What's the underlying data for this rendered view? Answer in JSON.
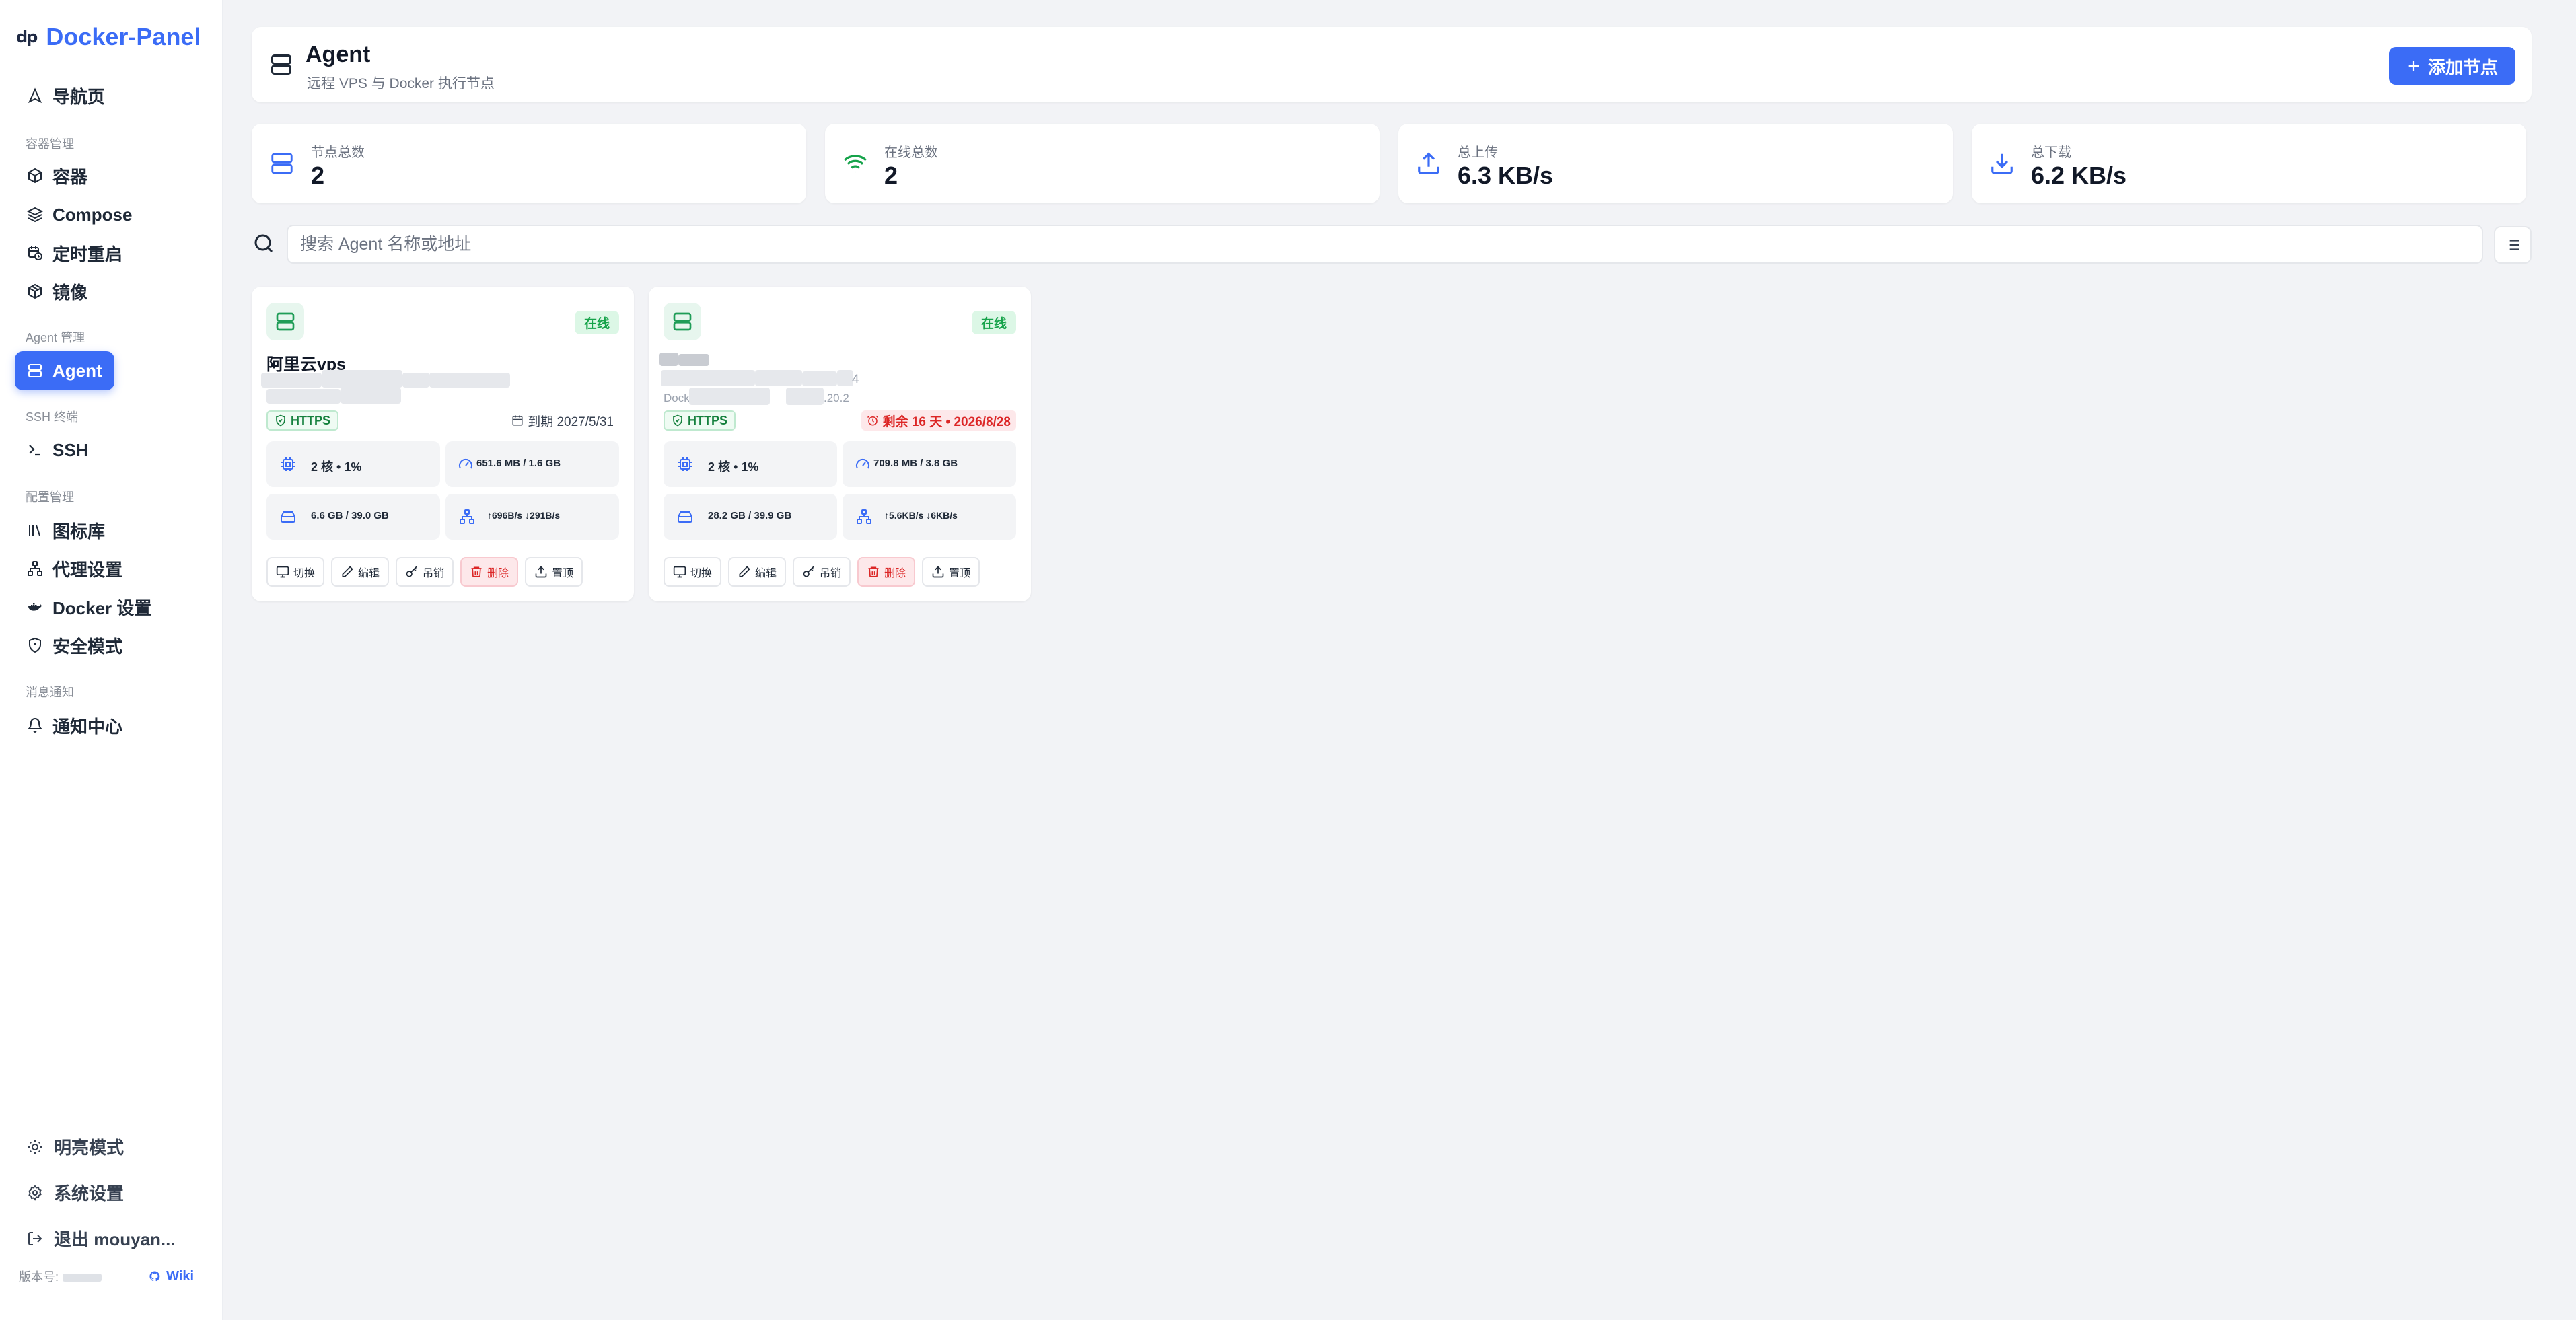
{
  "sidebar": {
    "brand": {
      "logo": "dp",
      "name": "Docker-Panel"
    },
    "items": [
      {
        "label": "导航页",
        "icon": "navigation-icon"
      },
      {
        "group": "容器管理"
      },
      {
        "label": "容器",
        "icon": "box-icon"
      },
      {
        "label": "Compose",
        "icon": "layers-icon"
      },
      {
        "label": "定时重启",
        "icon": "calendar-clock-icon"
      },
      {
        "label": "镜像",
        "icon": "package-icon"
      },
      {
        "group": "Agent 管理"
      },
      {
        "label": "Agent",
        "icon": "server-icon",
        "active": true
      },
      {
        "group": "SSH 终端"
      },
      {
        "label": "SSH",
        "icon": "terminal-icon"
      },
      {
        "group": "配置管理"
      },
      {
        "label": "图标库",
        "icon": "library-icon"
      },
      {
        "label": "代理设置",
        "icon": "network-icon"
      },
      {
        "label": "Docker 设置",
        "icon": "docker-whale-icon"
      },
      {
        "label": "安全模式",
        "icon": "shield-icon"
      },
      {
        "group": "消息通知"
      },
      {
        "label": "通知中心",
        "icon": "bell-icon"
      }
    ],
    "footer": {
      "theme": "明亮模式",
      "settings": "系统设置",
      "logout": "退出 mouyan...",
      "version_label": "版本号:",
      "wiki": "Wiki"
    }
  },
  "header": {
    "title": "Agent",
    "subtitle": "远程 VPS 与 Docker 执行节点",
    "add_button": "添加节点"
  },
  "stats": [
    {
      "label": "节点总数",
      "value": "2",
      "icon": "server-icon",
      "color": "#3b6cf6"
    },
    {
      "label": "在线总数",
      "value": "2",
      "icon": "wifi-icon",
      "color": "#16a34a"
    },
    {
      "label": "总上传",
      "value": "6.3 KB/s",
      "icon": "upload-icon",
      "color": "#3b6cf6"
    },
    {
      "label": "总下载",
      "value": "6.2 KB/s",
      "icon": "download-icon",
      "color": "#3b6cf6"
    }
  ],
  "search": {
    "placeholder": "搜索 Agent 名称或地址"
  },
  "agents": [
    {
      "name": "阿里云vps",
      "status": "在线",
      "tls": "HTTPS",
      "expiry": "到期 2027/5/31",
      "cpu": "2 核 • 1%",
      "ram": "651.6 MB / 1.6 GB",
      "disk": "6.6 GB / 39.0 GB",
      "net_up": "696B/s",
      "net_down": "291B/s"
    },
    {
      "name": "",
      "address_tail": "4",
      "docker_prefix": "Dock",
      "docker_suffix": ".20.2",
      "status": "在线",
      "tls": "HTTPS",
      "expiry": "剩余 16 天 • 2026/8/28",
      "cpu": "2 核 • 1%",
      "ram": "709.8 MB / 3.8 GB",
      "disk": "28.2 GB / 39.9 GB",
      "net_up": "5.6KB/s",
      "net_down": "6KB/s"
    }
  ],
  "card_actions": [
    "切换",
    "编辑",
    "吊销",
    "删除",
    "置顶"
  ],
  "colors": {
    "accent": "#3b6cf6",
    "online": "#16a34a",
    "danger": "#dc2626"
  }
}
